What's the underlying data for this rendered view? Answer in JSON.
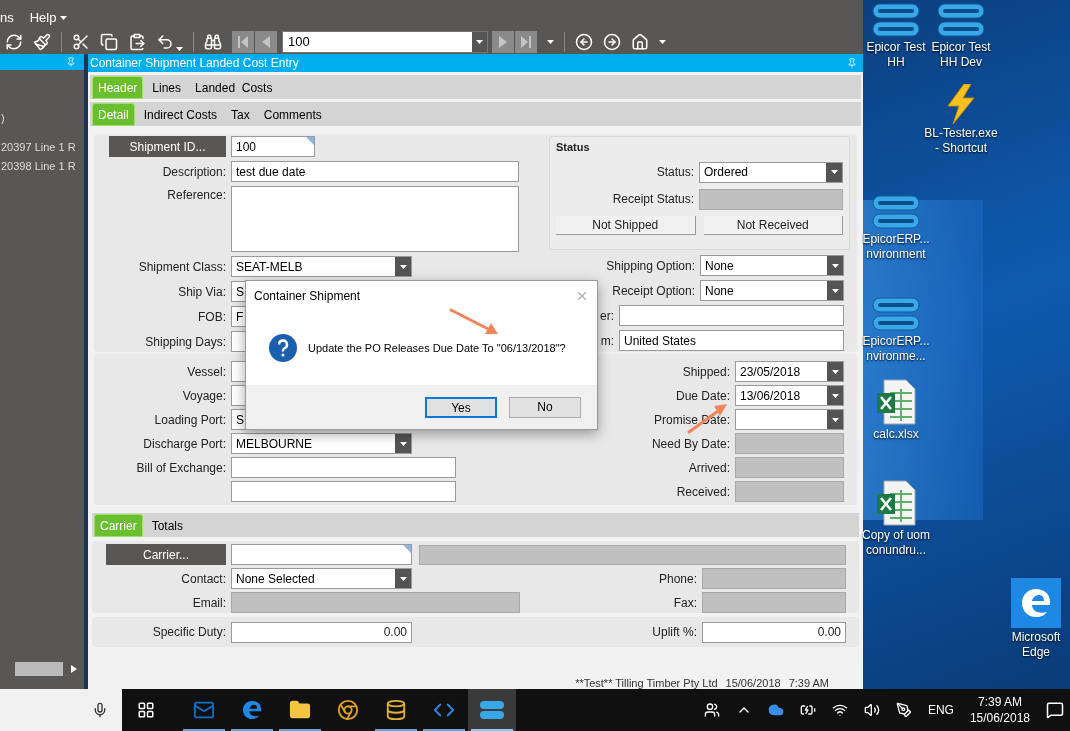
{
  "menu": [
    {
      "label": "ns"
    },
    {
      "label": "Help"
    }
  ],
  "toolbar": {
    "record": "100"
  },
  "side_panel": {
    "fragment": ")",
    "items": [
      "20397 Line 1 R",
      "20398 Line 1 R"
    ]
  },
  "window": {
    "title": "Container Shipment Landed Cost Entry"
  },
  "tabs": [
    {
      "label": "Header",
      "selected": true
    },
    {
      "label": "Lines",
      "selected": false
    },
    {
      "label": "Landed  Costs",
      "selected": false
    }
  ],
  "subtabs": [
    {
      "label": "Detail",
      "selected": true
    },
    {
      "label": "Indirect Costs",
      "selected": false
    },
    {
      "label": "Tax",
      "selected": false
    },
    {
      "label": "Comments",
      "selected": false
    }
  ],
  "header_left": [
    {
      "kind": "lookup",
      "label": "Shipment ID...",
      "value": "100"
    },
    {
      "kind": "text",
      "label": "Description:",
      "value": "test due date"
    },
    {
      "kind": "memo",
      "label": "Reference:"
    },
    {
      "kind": "combo",
      "label": "Shipment Class:",
      "value": "SEAT-MELB"
    },
    {
      "kind": "combo",
      "label": "Ship Via:",
      "value": "S"
    },
    {
      "kind": "combo",
      "label": "FOB:",
      "value": "F"
    },
    {
      "kind": "number",
      "label": "Shipping Days:"
    }
  ],
  "status": {
    "title": "Status",
    "fields": [
      {
        "kind": "combo",
        "label": "Status:",
        "value": "Ordered"
      },
      {
        "kind": "disabled",
        "label": "Receipt Status:"
      }
    ],
    "buttons": [
      "Not Shipped",
      "Not Received"
    ]
  },
  "header_right": [
    {
      "kind": "combo",
      "label": "Shipping Option:",
      "value": "None"
    },
    {
      "kind": "combo",
      "label": "Receipt Option:",
      "value": "None"
    },
    {
      "kind": "text",
      "label": "er:"
    },
    {
      "kind": "text",
      "label": "m:",
      "value": "United States"
    }
  ],
  "dates_left": [
    {
      "kind": "text",
      "label": "Vessel:"
    },
    {
      "kind": "text",
      "label": "Voyage:"
    },
    {
      "kind": "text",
      "label": "Loading Port:",
      "value": "S"
    },
    {
      "kind": "combo",
      "label": "Discharge Port:",
      "value": "MELBOURNE"
    },
    {
      "kind": "wide",
      "label": "Bill of Exchange:"
    },
    {
      "kind": "wide"
    }
  ],
  "dates_right": [
    {
      "kind": "date",
      "label": "Shipped:",
      "value": "23/05/2018"
    },
    {
      "kind": "date",
      "label": "Due Date:",
      "value": "13/06/2018"
    },
    {
      "kind": "date",
      "label": "Promise Date:"
    },
    {
      "kind": "disabled",
      "label": "Need By Date:"
    },
    {
      "kind": "disabled",
      "label": "Arrived:"
    },
    {
      "kind": "disabled",
      "label": "Received:"
    }
  ],
  "lower_tabs": [
    {
      "label": "Carrier",
      "selected": true
    },
    {
      "label": "Totals",
      "selected": false
    }
  ],
  "carrier": {
    "button": "Carrier...",
    "contact_label": "Contact:",
    "contact": "None Selected",
    "email_label": "Email:",
    "phone_label": "Phone:",
    "fax_label": "Fax:"
  },
  "duties": [
    {
      "label": "Specific Duty:",
      "value": "0.00"
    },
    {
      "label": "Uplift %:",
      "value": "0.00"
    }
  ],
  "status_bar": {
    "company": "**Test** Tilling Timber Pty Ltd",
    "date": "15/06/2018",
    "time": "7:39 AM"
  },
  "dialog": {
    "title": "Container Shipment",
    "message": "Update the PO Releases Due Date To \"06/13/2018\"?",
    "buttons": [
      {
        "label": "Yes",
        "selected": true
      },
      {
        "label": "No",
        "selected": false
      }
    ]
  },
  "desktop": {
    "icons": [
      {
        "kind": "epicor",
        "label": "Epicor Test HH"
      },
      {
        "kind": "epicor",
        "label": "Epicor Test HH Dev"
      },
      {
        "kind": "bolt",
        "label": "BL-Tester.exe - Shortcut"
      },
      {
        "kind": "epicor",
        "label": "EpicorERP... nvironment"
      },
      {
        "kind": "epicor",
        "label": "EpicorERP... nvironme..."
      },
      {
        "kind": "excel",
        "label": "calc.xlsx"
      },
      {
        "kind": "excel",
        "label": "Copy of uom conundru..."
      },
      {
        "kind": "edge",
        "label": "Microsoft Edge"
      }
    ]
  },
  "taskbar": {
    "apps": [
      {
        "kind": "outlook",
        "running": true,
        "selected": false
      },
      {
        "kind": "edge",
        "running": true,
        "selected": false
      },
      {
        "kind": "explorer",
        "running": true,
        "selected": false
      },
      {
        "kind": "chrome",
        "running": false,
        "selected": false
      },
      {
        "kind": "dbtool",
        "running": true,
        "selected": false
      },
      {
        "kind": "vscode",
        "running": true,
        "selected": false
      },
      {
        "kind": "epicor",
        "running": true,
        "selected": true
      }
    ],
    "language": "ENG",
    "time": "7:39 AM",
    "date": "15/06/2018"
  }
}
